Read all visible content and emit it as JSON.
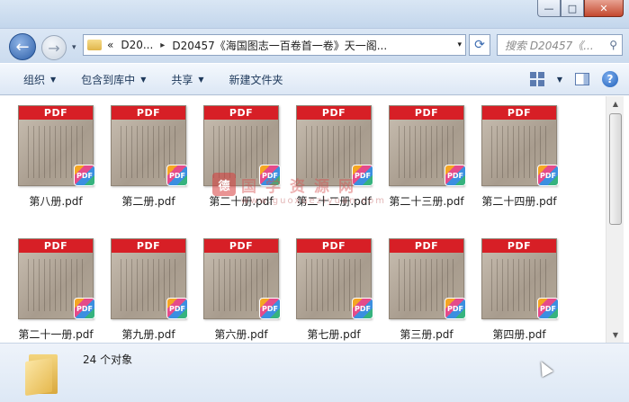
{
  "window": {
    "minimize_label": "—",
    "maximize_label": "□",
    "close_label": "✕"
  },
  "nav": {
    "back_icon": "←",
    "forward_icon": "→",
    "recent_icon": "▾"
  },
  "address": {
    "chevron": "«",
    "crumbs": [
      "D20...",
      "D20457《海国图志一百卷首一卷》天一阁..."
    ],
    "separator": "▸",
    "dropdown": "▾"
  },
  "refresh_icon": "⟳",
  "search": {
    "placeholder": "搜索 D20457《...",
    "icon": "⚲"
  },
  "toolbar": {
    "organize": "组织",
    "include_library": "包含到库中",
    "share": "共享",
    "new_folder": "新建文件夹",
    "caret": "▼"
  },
  "thumbnail_banner": "PDF",
  "badge_label": "PDF",
  "files": [
    "第八册.pdf",
    "第二册.pdf",
    "第二十册.pdf",
    "第二十二册.pdf",
    "第二十三册.pdf",
    "第二十四册.pdf",
    "第二十一册.pdf",
    "第九册.pdf",
    "第六册.pdf",
    "第七册.pdf",
    "第三册.pdf",
    "第四册.pdf"
  ],
  "watermark": {
    "seal": "德",
    "text": "国学资源网",
    "url": "www.guoxueziyuan.com"
  },
  "status": {
    "count": "24 个对象"
  },
  "colors": {
    "pdf_banner": "#d71f26",
    "toolbar_text": "#1e395b"
  }
}
